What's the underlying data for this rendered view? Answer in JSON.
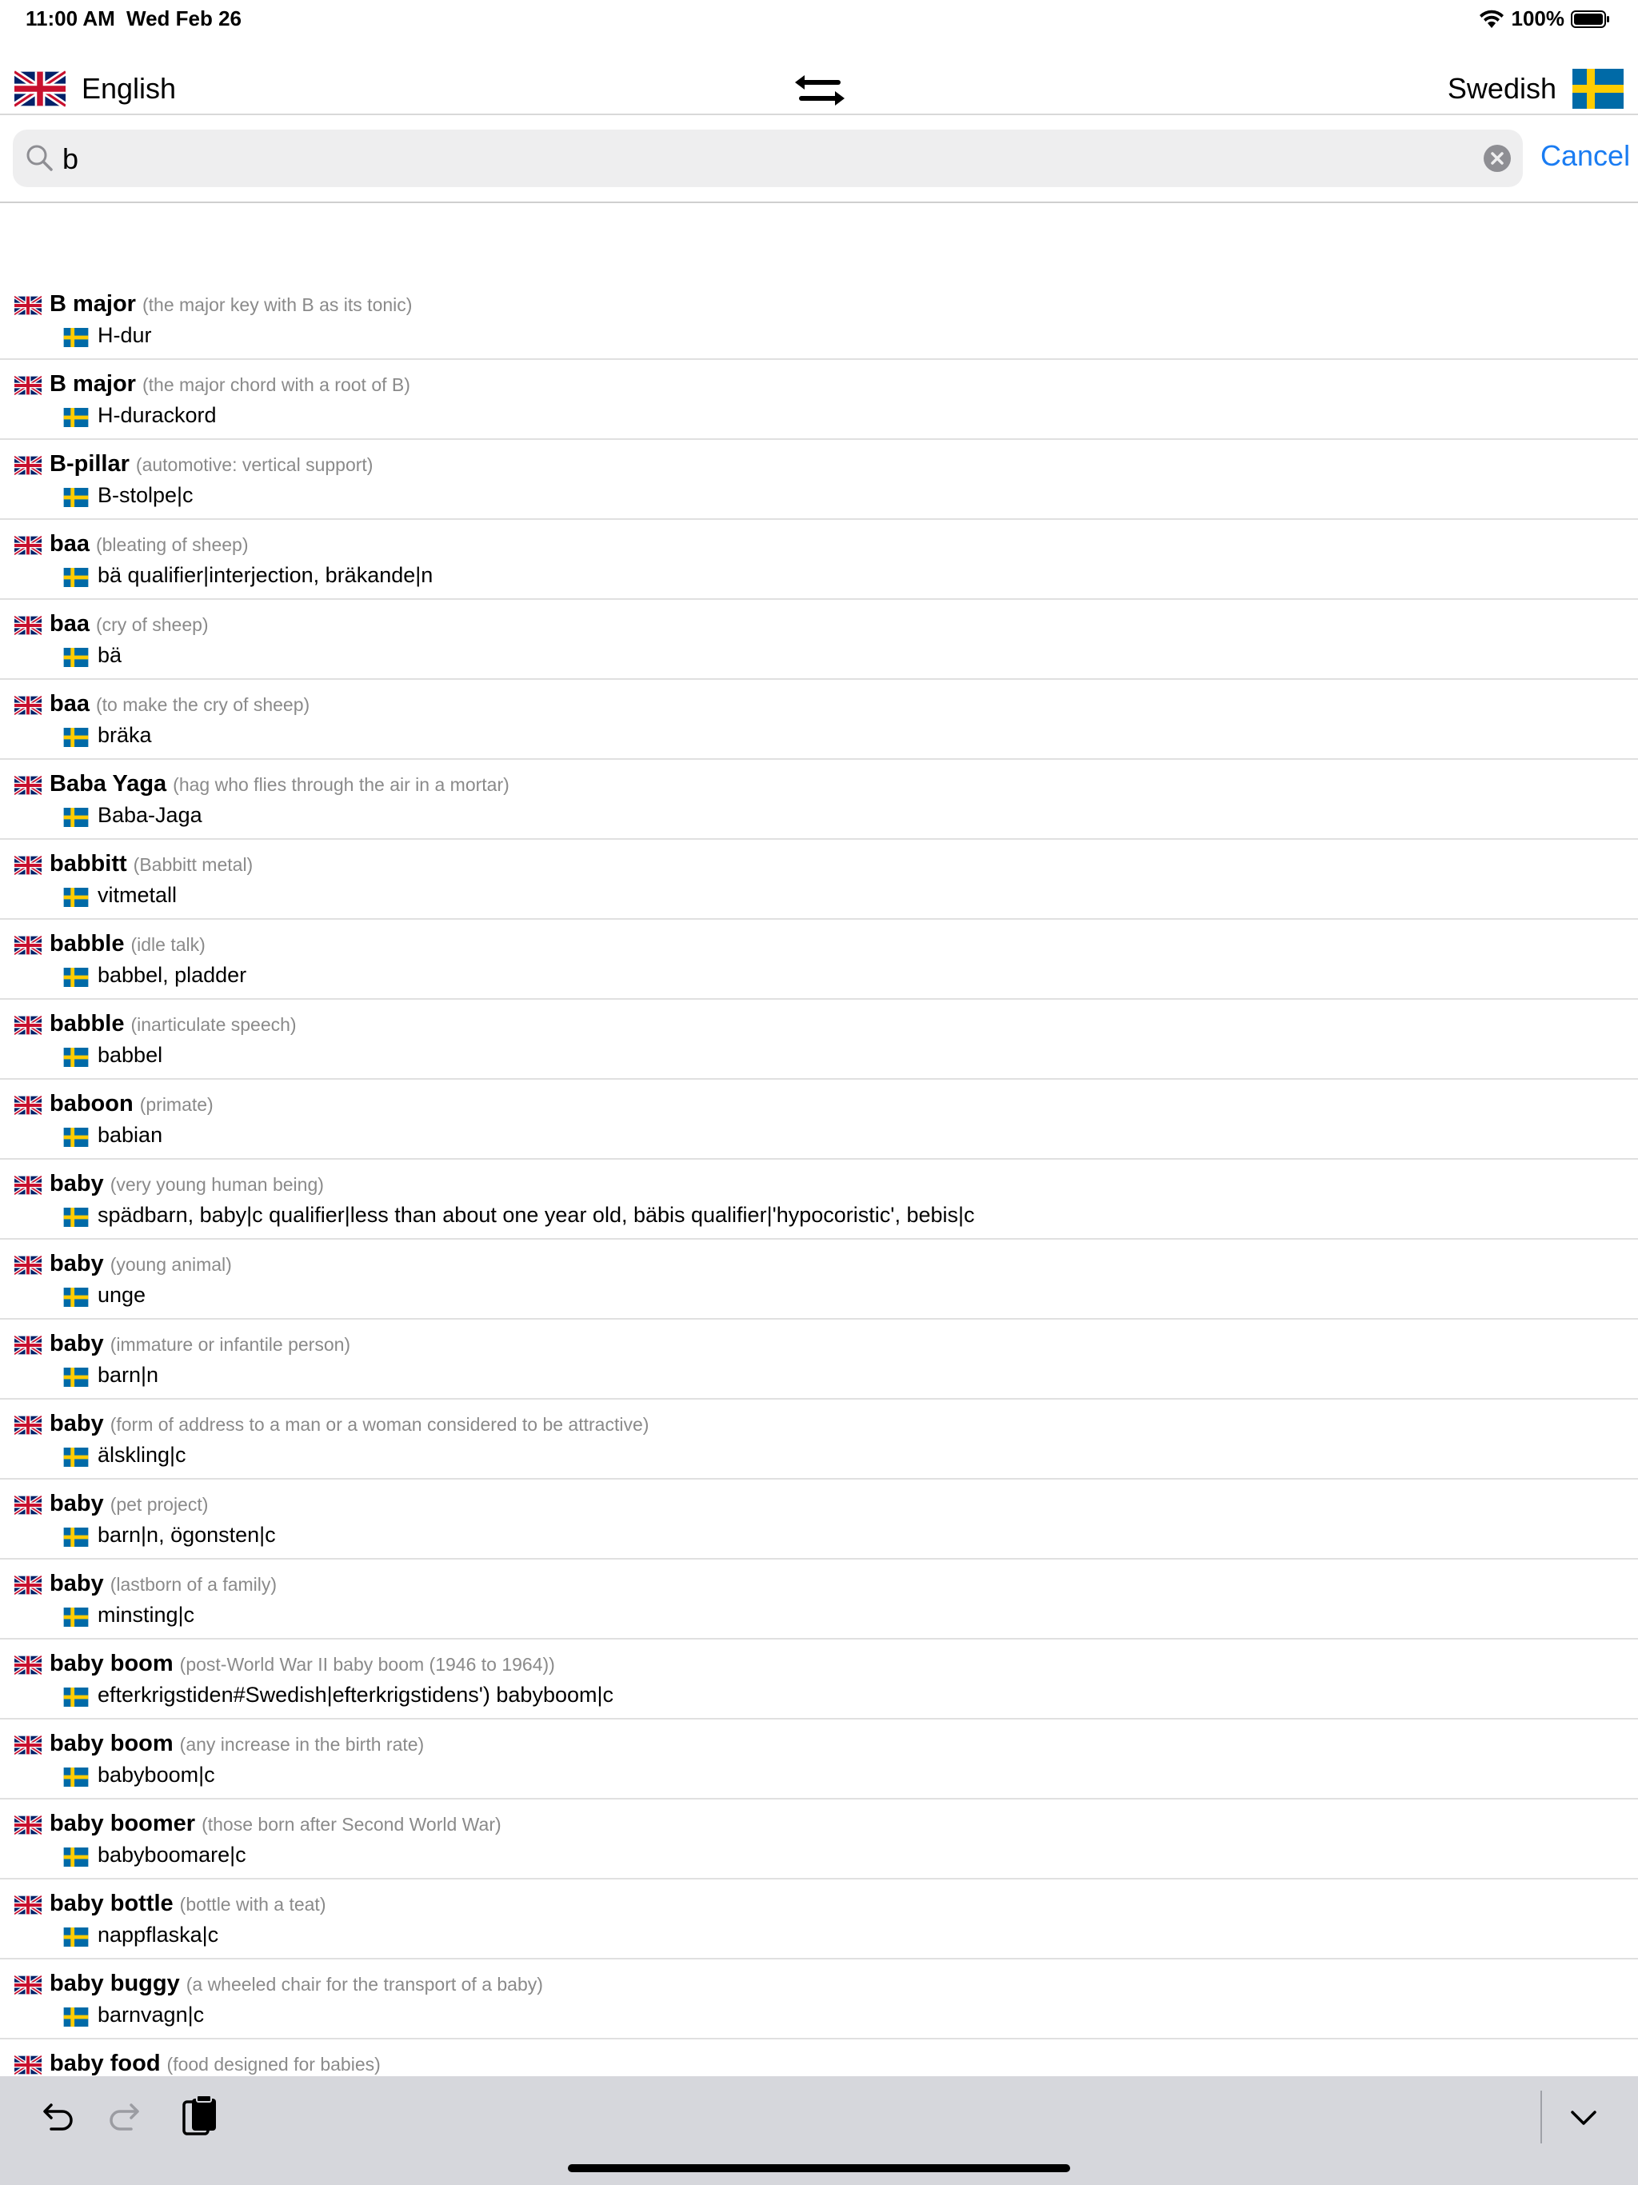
{
  "status": {
    "time": "11:00 AM",
    "date": "Wed Feb 26",
    "battery": "100%"
  },
  "header": {
    "source_language": "English",
    "target_language": "Swedish"
  },
  "search": {
    "value": "b",
    "cancel_label": "Cancel"
  },
  "results": [
    {
      "word": "B major",
      "desc": "(the major key with B as its tonic)",
      "translation": "H-dur"
    },
    {
      "word": "B major",
      "desc": "(the major chord with a root of B)",
      "translation": "H-durackord"
    },
    {
      "word": "B-pillar",
      "desc": "(automotive: vertical support)",
      "translation": "B-stolpe|c"
    },
    {
      "word": "baa",
      "desc": "(bleating of sheep)",
      "translation": "bä qualifier|interjection, bräkande|n"
    },
    {
      "word": "baa",
      "desc": "(cry of sheep)",
      "translation": "bä"
    },
    {
      "word": "baa",
      "desc": "(to make the cry of sheep)",
      "translation": "bräka"
    },
    {
      "word": "Baba Yaga",
      "desc": "(hag who flies through the air in a mortar)",
      "translation": "Baba-Jaga"
    },
    {
      "word": "babbitt",
      "desc": "(Babbitt metal)",
      "translation": "vitmetall"
    },
    {
      "word": "babble",
      "desc": "(idle talk)",
      "translation": "babbel, pladder"
    },
    {
      "word": "babble",
      "desc": "(inarticulate speech)",
      "translation": "babbel"
    },
    {
      "word": "baboon",
      "desc": "(primate)",
      "translation": "babian"
    },
    {
      "word": "baby",
      "desc": "(very young human being)",
      "translation": "spädbarn, baby|c qualifier|less than about one year old, bäbis qualifier|'hypocoristic', bebis|c"
    },
    {
      "word": "baby",
      "desc": "(young animal)",
      "translation": "unge"
    },
    {
      "word": "baby",
      "desc": "(immature or infantile person)",
      "translation": "barn|n"
    },
    {
      "word": "baby",
      "desc": "(form of address to a man or a woman considered to be attractive)",
      "translation": "älskling|c"
    },
    {
      "word": "baby",
      "desc": "(pet project)",
      "translation": "barn|n, ögonsten|c"
    },
    {
      "word": "baby",
      "desc": "(lastborn of a family)",
      "translation": "minsting|c"
    },
    {
      "word": "baby boom",
      "desc": "(post-World War II baby boom (1946 to 1964))",
      "translation": "efterkrigstiden#Swedish|efterkrigstidens') babyboom|c"
    },
    {
      "word": "baby boom",
      "desc": "(any increase in the birth rate)",
      "translation": "babyboom|c"
    },
    {
      "word": "baby boomer",
      "desc": "(those born after Second World War)",
      "translation": "babyboomare|c"
    },
    {
      "word": "baby bottle",
      "desc": "(bottle with a teat)",
      "translation": "nappflaska|c"
    },
    {
      "word": "baby buggy",
      "desc": "(a wheeled chair for the transport of a baby)",
      "translation": "barnvagn|c"
    },
    {
      "word": "baby food",
      "desc": "(food designed for babies)",
      "translation": ""
    }
  ]
}
